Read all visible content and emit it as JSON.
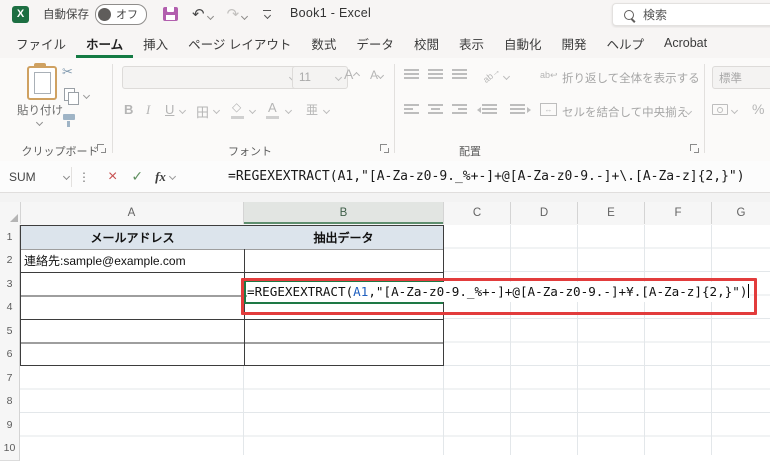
{
  "title_bar": {
    "autosave_label": "自動保存",
    "autosave_state": "オフ",
    "doc_title": "Book1  -  Excel",
    "search_placeholder": "検索"
  },
  "ribbon": {
    "tabs": [
      {
        "label": "ファイル"
      },
      {
        "label": "ホーム"
      },
      {
        "label": "挿入"
      },
      {
        "label": "ページ レイアウト"
      },
      {
        "label": "数式"
      },
      {
        "label": "データ"
      },
      {
        "label": "校閲"
      },
      {
        "label": "表示"
      },
      {
        "label": "自動化"
      },
      {
        "label": "開発"
      },
      {
        "label": "ヘルプ"
      },
      {
        "label": "Acrobat"
      }
    ],
    "clipboard": {
      "label": "クリップボード",
      "paste_label": "貼り付け"
    },
    "font": {
      "label": "フォント",
      "size_value": "11",
      "bold": "B",
      "italic": "I",
      "underline": "U",
      "size_letter": "A"
    },
    "alignment": {
      "label": "配置",
      "wrap_label": "折り返して全体を表示する",
      "merge_label": "セルを結合して中央揃え"
    },
    "number": {
      "format_value": "標準",
      "percent": "%"
    }
  },
  "formula_bar": {
    "name_box": "SUM",
    "fx_label": "fx",
    "formula": "=REGEXEXTRACT(A1,\"[A-Za-z0-9._%+-]+@[A-Za-z0-9.-]+\\.[A-Za-z]{2,}\")"
  },
  "grid": {
    "columns": [
      "A",
      "B",
      "C",
      "D",
      "E",
      "F",
      "G"
    ],
    "rows": [
      "1",
      "2",
      "3",
      "4",
      "5",
      "6",
      "7",
      "8",
      "9",
      "10"
    ],
    "cells": {
      "a1": "メールアドレス",
      "b1": "抽出データ",
      "a2": "連絡先:sample@example.com",
      "b2_prefix": "=REGEXEXTRACT(",
      "b2_ref": "A1",
      "b2_suffix": ",\"[A-Za-z0-9._%+-]+@[A-Za-z0-9.-]+¥.[A-Za-z]{2,}\")"
    }
  },
  "icons": {
    "excel_logo_letter": "X",
    "undo": "↶",
    "redo": "↷",
    "cancel": "×",
    "enter": "✓",
    "more_dots": "⋮",
    "scissors": "✂",
    "borders_grid": "田",
    "phonetic": "亜",
    "merge_arrows": "↔",
    "wrap_text": "ab↩",
    "orientation_text": "ab→"
  },
  "colors": {
    "excel_green": "#147a43",
    "selection_green": "#1e7945",
    "annotation_red": "#e23c3c",
    "ref_blue": "#1f5fbf",
    "header_fill": "#dce4ec"
  }
}
